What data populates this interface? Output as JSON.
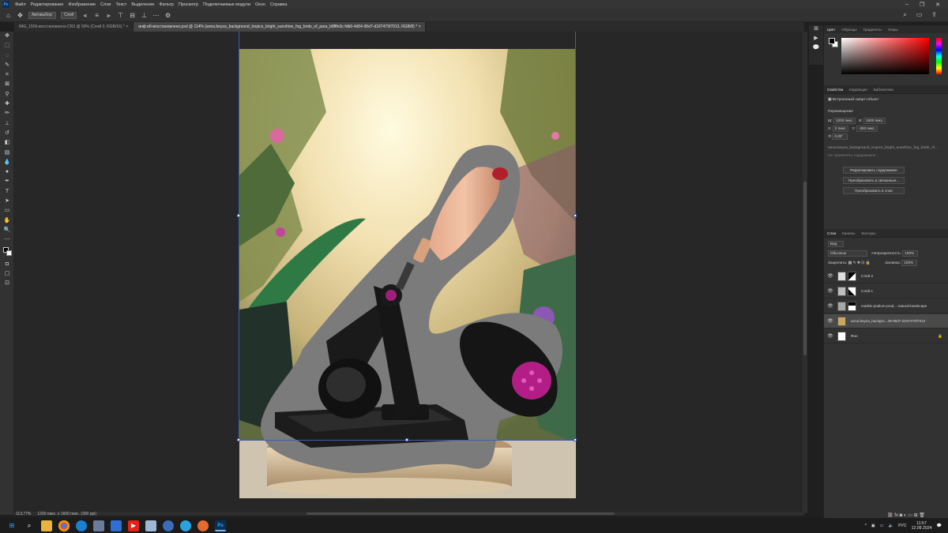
{
  "app": {
    "menu": [
      "Файл",
      "Редактирование",
      "Изображение",
      "Слои",
      "Текст",
      "Выделение",
      "Фильтр",
      "Просмотр",
      "Подключаемые модули",
      "Окно",
      "Справка"
    ]
  },
  "options": {
    "autoselect_label": "Автовыбор:",
    "autoselect_value": "Слой"
  },
  "tabs": [
    {
      "label": "IMG_1556-восстановлено.CR2 @ 50% (Слой 0, RGB/16) *",
      "close": "×"
    },
    {
      "label": "инф вб-восстановлено.psd @ 114% (anna.beyza_background_tropics_bright_sunshine_fog_birds_of_para_b8fffe3c-fdb0-4d04-96d7-d187475f7013, RGB/8) *",
      "close": "×"
    }
  ],
  "status": {
    "zoom": "113,77%",
    "size": "1200 пикс. x 1600 пикс. (300 ppi)"
  },
  "panels": {
    "color_tabs": [
      "Цвет",
      "Образцы",
      "Градиенты",
      "Узоры"
    ],
    "props_tabs": [
      "Свойства",
      "Коррекция",
      "Библиотеки"
    ],
    "smart_object": "Встроенный смарт-объект",
    "transform_title": "Перемещение",
    "w": "1200 пикс.",
    "h": "1600 пикс.",
    "x": "0 пикс.",
    "y": "-353 пикс.",
    "angle": "0,00°",
    "filename": "anna.beyza_background_tropics_bright_sunshine_fog_birds_of...",
    "placeholder": "Не применять содержимое...",
    "btn_edit": "Редактировать содержимое",
    "btn_convert_linked": "Преобразовать в связанные...",
    "btn_convert_layers": "Преобразовать в слои",
    "layers_tabs": [
      "Слои",
      "Каналы",
      "Контуры"
    ],
    "search": "Вид",
    "blend_mode": "Обычные",
    "opacity_label": "Непрозрачность:",
    "opacity": "100%",
    "lock_label": "Закрепить:",
    "fill_label": "Заливка:",
    "fill": "100%",
    "layers": [
      {
        "name": "Слой 2"
      },
      {
        "name": "Слой 1"
      },
      {
        "name": "marble-podium-prod...-natural-landscape"
      },
      {
        "name": "anna.beyza_backgro...49-96d7-d187475f7013"
      },
      {
        "name": "Фон"
      }
    ]
  },
  "taskbar": {
    "lang": "РУС",
    "time": "11:57",
    "date": "12.09.2024"
  }
}
